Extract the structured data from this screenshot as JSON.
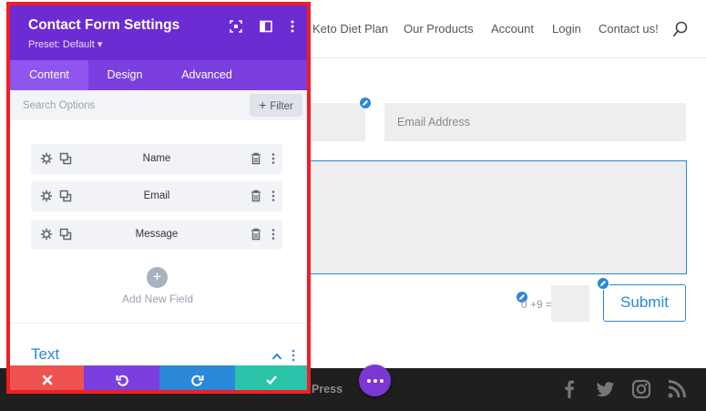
{
  "nav": {
    "items": [
      "Keto Diet Plan",
      "Our Products",
      "Account",
      "Login",
      "Contact us!"
    ]
  },
  "form": {
    "email_placeholder": "Email Address",
    "captcha": "0 +9 =",
    "submit_label": "Submit"
  },
  "footer": {
    "text": "Press",
    "social_icons": [
      "facebook-icon",
      "twitter-icon",
      "instagram-icon",
      "rss-icon"
    ]
  },
  "panel": {
    "title": "Contact Form Settings",
    "preset": "Preset: Default ▾",
    "tabs": [
      "Content",
      "Design",
      "Advanced"
    ],
    "active_tab": "Content",
    "search_placeholder": "Search Options",
    "filter_label": "Filter",
    "fields": [
      "Name",
      "Email",
      "Message"
    ],
    "add_field_label": "Add New Field",
    "section_title": "Text"
  },
  "colors": {
    "panel_header": "#6c2bd3",
    "tab_bar": "#7b3fe0",
    "highlight_border": "#ee1f24",
    "accent_blue": "#2b87da",
    "cancel": "#ef5350",
    "undo": "#7b3fe0",
    "redo": "#2b87da",
    "save": "#29c4a9"
  }
}
